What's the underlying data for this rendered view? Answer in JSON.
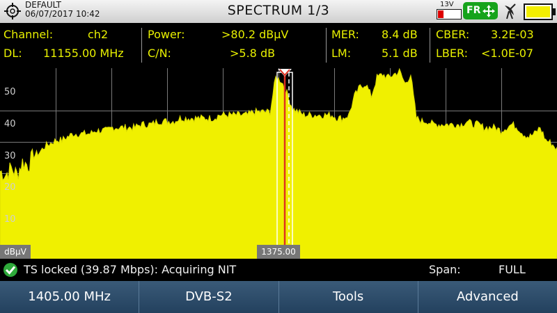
{
  "header": {
    "profile": "DEFAULT",
    "datetime": "06/07/2017 10:42",
    "title": "SPECTRUM 1/3",
    "voltage": "13V",
    "fr_label": "FR"
  },
  "measurements": {
    "channel_label": "Channel:",
    "channel_value": "ch2",
    "dl_label": "DL:",
    "dl_value": "11155.00 MHz",
    "power_label": "Power:",
    "power_value": ">80.2 dBµV",
    "cn_label": "C/N:",
    "cn_value": ">5.8 dB",
    "mer_label": "MER:",
    "mer_value": "8.4 dB",
    "lm_label": "LM:",
    "lm_value": "5.1 dB",
    "cber_label": "CBER:",
    "cber_value": "3.2E-03",
    "lber_label": "LBER:",
    "lber_value": "<1.0E-07"
  },
  "chart_data": {
    "type": "area",
    "ylabel": "dBµV",
    "yticks": [
      "50",
      "40",
      "30",
      "20",
      "10"
    ],
    "ylim": [
      0,
      61
    ],
    "marker_label": "1375.00",
    "color": "#f0f000",
    "grid": true,
    "series": [
      {
        "values": [
          28,
          27,
          29,
          27,
          31,
          30,
          33,
          34,
          36,
          37,
          38,
          38,
          39,
          40,
          40,
          40,
          40,
          41,
          41,
          41,
          42,
          42,
          42,
          42,
          42,
          43,
          43,
          43,
          44,
          44,
          44,
          44,
          45,
          45,
          45,
          45,
          45,
          45,
          45,
          46,
          46,
          46,
          46,
          46,
          46,
          47,
          47,
          47,
          47,
          58,
          57,
          53,
          48,
          47,
          46,
          46,
          46,
          46,
          46,
          46,
          45,
          45,
          46,
          52,
          55,
          56,
          52,
          58,
          59,
          58,
          59,
          60,
          56,
          59,
          45,
          44,
          44,
          43,
          43,
          43,
          43,
          43,
          43,
          44,
          43,
          43,
          42,
          42,
          42,
          41,
          42,
          43,
          42,
          40,
          39,
          40,
          42,
          38,
          37,
          35
        ]
      }
    ]
  },
  "status": {
    "message": "TS locked (39.87 Mbps): Acquiring NIT",
    "span_label": "Span:",
    "span_value": "FULL"
  },
  "softkeys": [
    "1405.00 MHz",
    "DVB-S2",
    "Tools",
    "Advanced"
  ]
}
